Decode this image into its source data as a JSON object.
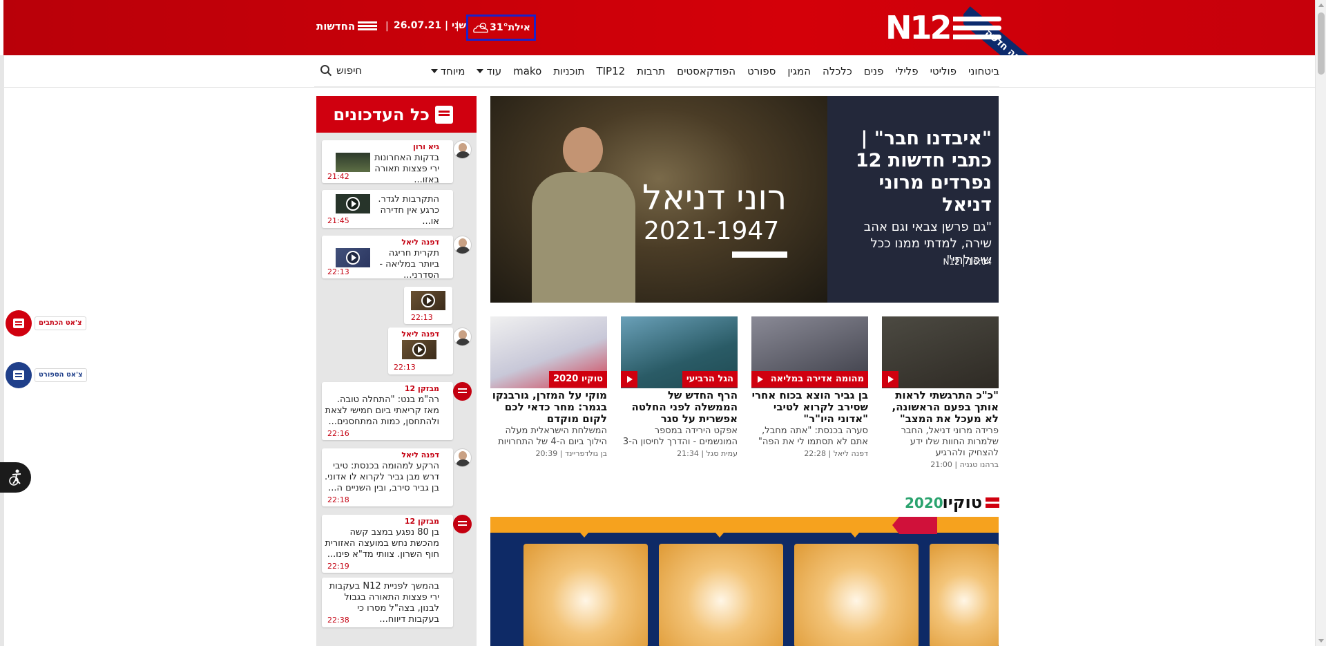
{
  "header": {
    "logo_text": "N12",
    "ribbon_text": "גרסה חדשה",
    "weather": {
      "city": "אילת",
      "temp": "31°"
    },
    "day": "שני",
    "date": "26.07.21",
    "news_label": "החדשות",
    "separator": "|"
  },
  "nav": {
    "items": [
      "ביטחוני",
      "פוליטי",
      "פלילי",
      "פנים",
      "כלכלה",
      "המגין",
      "ספורט",
      "הפודקאסטים",
      "תרבות",
      "TIP12",
      "תוכניות",
      "mako"
    ],
    "more_label": "עוד",
    "special_label": "מיוחד",
    "search_label": "חיפוש"
  },
  "updates": {
    "title": "כל העדכונים",
    "items": [
      {
        "author": "גיא ורון",
        "text": "בדקות האחרונות ירי פצצות תאורה באזו...",
        "time": "21:42"
      },
      {
        "author": "",
        "text": "התקרבות לגדר. כרגע אין חדירה או...",
        "time": "21:45"
      },
      {
        "author": "דפנה ליאל",
        "text": "תקרית חריגה ביותר במליאה - הסדרני...",
        "time": "22:13"
      },
      {
        "author": "",
        "text": "",
        "time": "22:13"
      },
      {
        "author": "דפנה ליאל",
        "text": "",
        "time": "22:13"
      },
      {
        "author": "מבזקן 12",
        "text": "רה\"מ בנט: \"התחלה טובה. מאז קריאתי ביום חמישי לצאת ולהתחסן, כמות המתחסנים...",
        "time": "22:16"
      },
      {
        "author": "דפנה ליאל",
        "text": "הרקע למהומה בכנסת: טיבי דרש מבן גביר לקרוא לו אדוני. בן גביר סירב, ובין השניים ה...",
        "time": "22:18"
      },
      {
        "author": "מבזקן 12",
        "text": "בן 80 נפגע במצב קשה מהכשת נחש במועצה האזורית חוף השרון. צוותי מד\"א פינו...",
        "time": "22:19"
      },
      {
        "author": "",
        "text": "בהמשך לפניית N12 בעקבות ירי פצצות התאורה בגבול לבנון, בצה\"ל מסרו כי בעקבות דיווח...",
        "time": "22:38"
      }
    ]
  },
  "hero": {
    "title": "\"איבדנו חבר\" | כתבי חדשות 12 נפרדים מרוני דניאל",
    "subtitle": "\"גם פרשן צבאי וגם אהב שירה, למדתי ממנו ככל שיכולתי\"",
    "time": "16:04",
    "source": "N12",
    "photo_name": "רוני דניאל",
    "photo_years": "2021-1947"
  },
  "articles": [
    {
      "tag": "",
      "title": "\"כ\"כ התרגשתי לראות אותך בפעם הראשונה, לא מעכל את המצב\"",
      "summary": "פרידה מרוני דניאל, החבר שלמרות החוות שלו ידע להצחיק ולהרגיע",
      "author": "ברהנו טגניה",
      "time": "21:00"
    },
    {
      "tag": "מהומה אדירה במליאה",
      "title": "בן גביר הוצא בכוח אחרי שסירב לקרוא לטיבי \"אדוני היו\"ר\"",
      "summary": "סערה בכנסת: \"אתה מחבל, אתם לא תסתמו לי את הפה\"",
      "author": "דפנה ליאל",
      "time": "22:28"
    },
    {
      "tag": "הגל הרביעי",
      "title": "הרף החדש של הממשלה לפני החלטה אפשרית על סגר",
      "summary": "אפקט הירידה במספר המונשמים - והדרך לחיסון ה-3",
      "author": "עמית סגל",
      "time": "21:34"
    },
    {
      "tag": "טוקיו 2020",
      "title": "מוקי על המזרן, גורבנקו בגמר: מחר כדאי לכם לקום מוקדם",
      "summary": "המשלחת הישראלית מעלה הילוך ביום ה-4 של התחרויות",
      "author": "בן גולדפריינד",
      "time": "20:39"
    }
  ],
  "tokyo": {
    "word": "טוקיו",
    "year": "2020"
  },
  "side": {
    "chat_writers": "צ'אט הכתבים",
    "chat_sport": "צ'אט הספורט"
  },
  "colors": {
    "brand_red": "#d0000f",
    "navy": "#0e2a66",
    "orange": "#f6a21e"
  }
}
